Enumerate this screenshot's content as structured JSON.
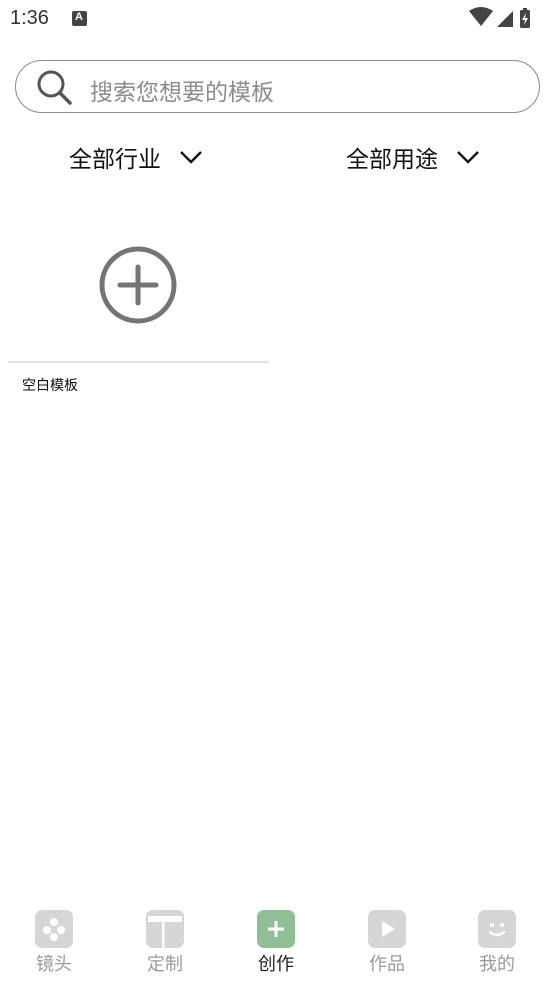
{
  "status_bar": {
    "time": "1:36",
    "notification_icon": "a-letter-icon",
    "icons": [
      "wifi-icon",
      "signal-icon",
      "battery-charging-icon"
    ]
  },
  "search": {
    "placeholder": "搜索您想要的模板",
    "icon": "search-icon"
  },
  "filters": {
    "industry": "全部行业",
    "usage": "全部用途"
  },
  "templates": [
    {
      "label": "空白模板",
      "icon": "plus-circle-icon"
    }
  ],
  "bottom_nav": {
    "items": [
      {
        "label": "镜头",
        "icon": "lens-icon",
        "active": false
      },
      {
        "label": "定制",
        "icon": "layout-icon",
        "active": false
      },
      {
        "label": "创作",
        "icon": "plus-icon",
        "active": true
      },
      {
        "label": "作品",
        "icon": "play-icon",
        "active": false
      },
      {
        "label": "我的",
        "icon": "smile-icon",
        "active": false
      }
    ],
    "colors": {
      "active_icon_bg": "#8fbf94",
      "inactive_icon_bg": "#d6d6d6",
      "inactive_label": "#9a9a9a"
    }
  }
}
